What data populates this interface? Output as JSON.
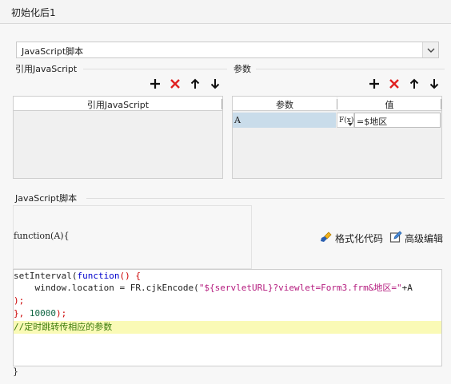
{
  "tab": {
    "title": "初始化后1"
  },
  "script_type": {
    "selected": "JavaScript脚本"
  },
  "ref_section": {
    "label": "引用JavaScript",
    "column_header": "引用JavaScript"
  },
  "params_section": {
    "label": "参数",
    "headers": [
      "参数",
      "值"
    ],
    "rows": [
      {
        "name": "A",
        "fx": "F(x)",
        "value": "=$地区"
      }
    ]
  },
  "script_section": {
    "label": "JavaScript脚本",
    "signature": "function(A){",
    "format_code": "格式化代码",
    "advanced_edit": "高级编辑",
    "closing": "}"
  },
  "code": {
    "l1_a": "setInterval(",
    "l1_kw": "function",
    "l1_b": "() {",
    "l2_indent": "    ",
    "l2_a": "window.location = FR.cjkEncode(",
    "l2_str": "\"${servletURL}?viewlet=Form3.frm&地区=\"",
    "l2_b": "+A",
    "l3": ");",
    "l4_a": "}, ",
    "l4_num": "10000",
    "l4_b": ");",
    "l5_comment": "//定时跳转传相应的参数"
  },
  "colors": {
    "highlight_line": "#fafab6",
    "selected_cell": "#c9dcea",
    "delete_icon": "#e02020"
  }
}
